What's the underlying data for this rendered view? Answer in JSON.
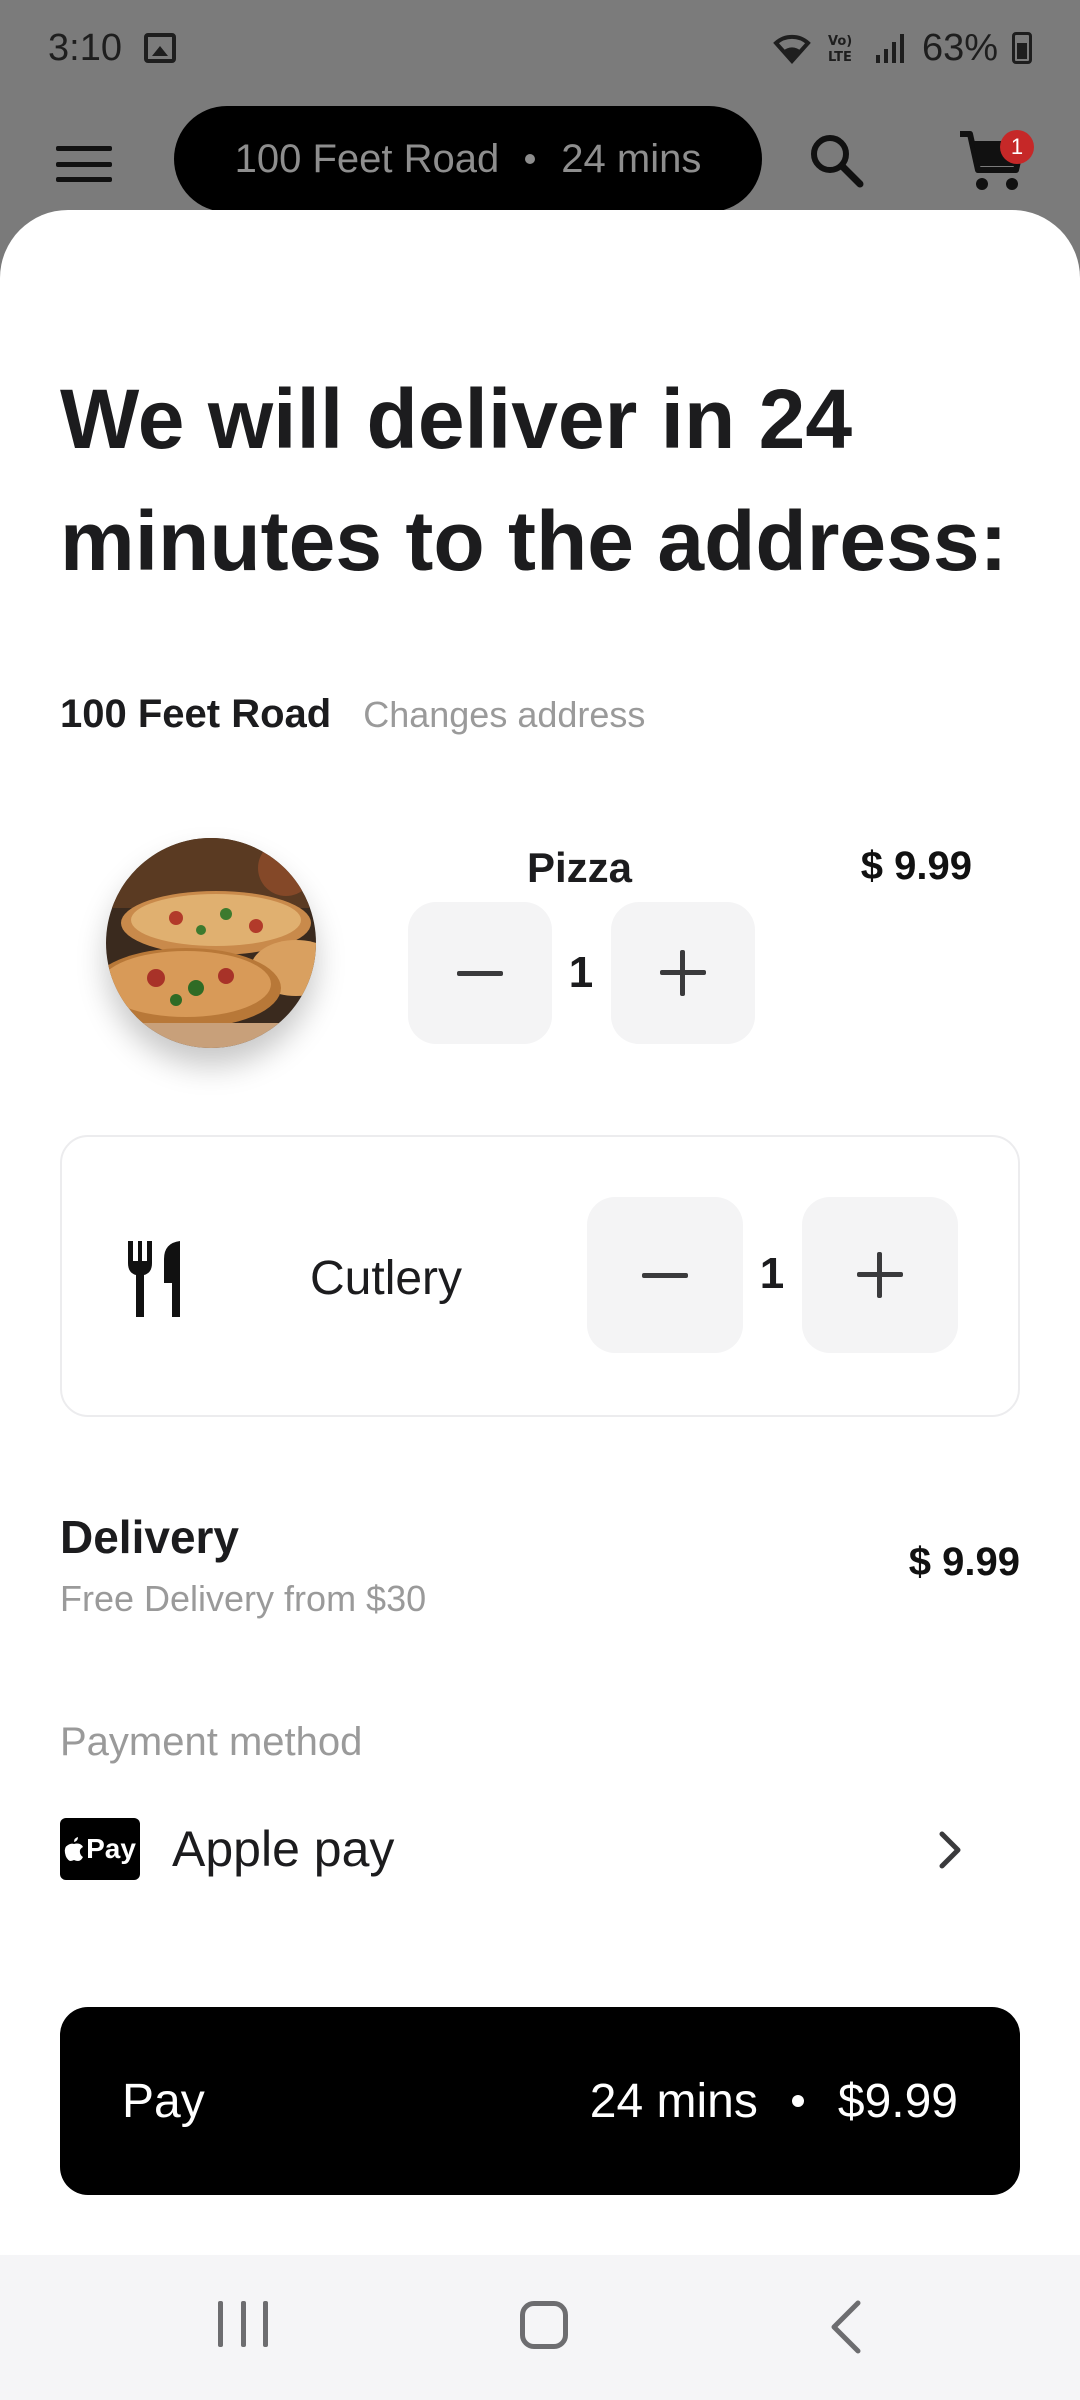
{
  "status_bar": {
    "time": "3:10",
    "battery": "63%",
    "icons": [
      "image-icon",
      "wifi-icon",
      "volte-icon",
      "signal-icon",
      "battery-icon"
    ]
  },
  "topbar": {
    "address": "100 Feet Road",
    "eta": "24 mins",
    "cart_count": "1",
    "icons": [
      "menu-icon",
      "search-icon",
      "cart-icon"
    ]
  },
  "sheet": {
    "headline": "We will deliver in 24 minutes to the address:",
    "address_name": "100 Feet Road",
    "change_address": "Changes address",
    "item": {
      "name": "Pizza",
      "quantity": "1",
      "price": "$ 9.99"
    },
    "cutlery": {
      "label": "Cutlery",
      "quantity": "1"
    },
    "delivery": {
      "title": "Delivery",
      "subtitle": "Free Delivery from $30",
      "price": "$ 9.99"
    },
    "payment": {
      "label": "Payment method",
      "badge": "Pay",
      "method": "Apple pay"
    },
    "pay_button": {
      "label": "Pay",
      "eta": "24 mins",
      "total": "$9.99"
    }
  },
  "colors": {
    "accent": "#000000",
    "stepper_bg": "#f4f4f5",
    "muted_text": "#9a9a9a",
    "badge": "#c62828"
  }
}
